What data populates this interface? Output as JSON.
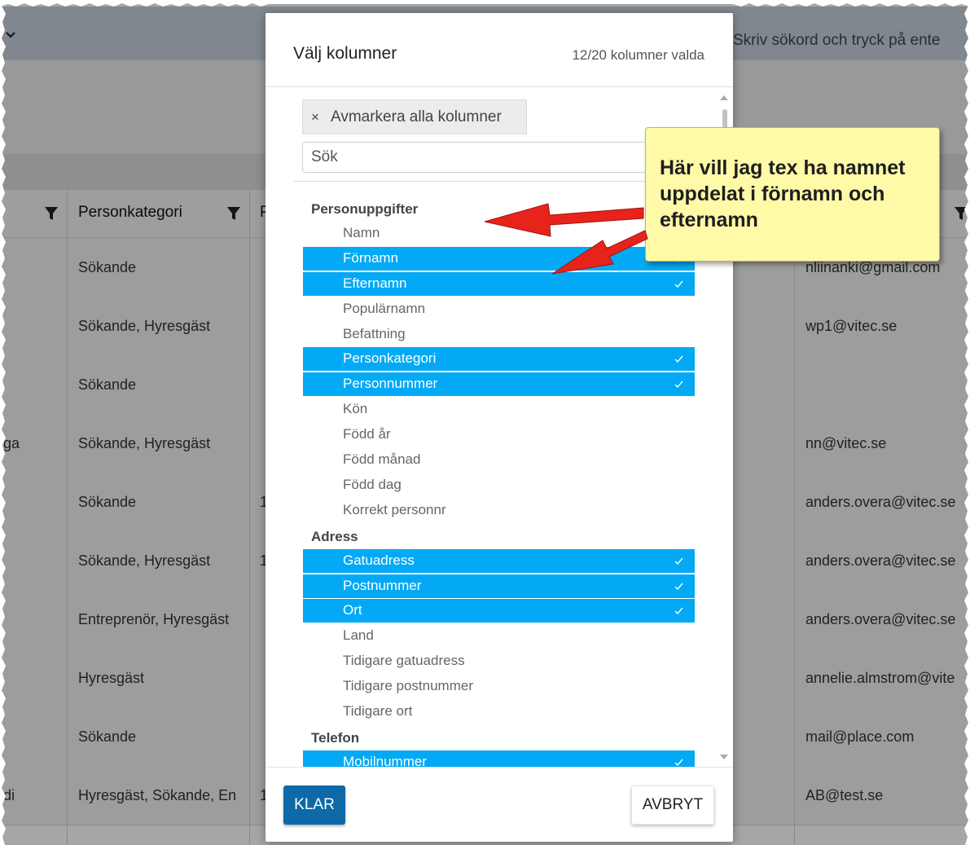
{
  "background": {
    "search_placeholder": "Skriv sökord och tryck på ente",
    "header": {
      "col_personkategori": "Personkategori",
      "col_next_initial": "P"
    },
    "rows": [
      {
        "left": "",
        "kategori": "Sökande",
        "p": "",
        "email": "nliinanki@gmail.com"
      },
      {
        "left": "",
        "kategori": "Sökande, Hyresgäst",
        "p": "",
        "email": "wp1@vitec.se"
      },
      {
        "left": "",
        "kategori": "Sökande",
        "p": "",
        "email": ""
      },
      {
        "left": "ga",
        "kategori": "Sökande, Hyresgäst",
        "p": "",
        "email": "nn@vitec.se"
      },
      {
        "left": "",
        "kategori": "Sökande",
        "p": "1",
        "email": "anders.overa@vitec.se"
      },
      {
        "left": "",
        "kategori": "Sökande, Hyresgäst",
        "p": "1",
        "email": "anders.overa@vitec.se"
      },
      {
        "left": "",
        "kategori": "Entreprenör, Hyresgäst",
        "p": "",
        "email": "anders.overa@vitec.se"
      },
      {
        "left": "",
        "kategori": "Hyresgäst",
        "p": "",
        "email": "annelie.almstrom@vite"
      },
      {
        "left": "",
        "kategori": "Sökande",
        "p": "",
        "email": "mail@place.com"
      },
      {
        "left": "di",
        "kategori": "Hyresgäst, Sökande, En",
        "p": "1",
        "email": "AB@test.se"
      }
    ]
  },
  "modal": {
    "title": "Välj kolumner",
    "count": "12/20 kolumner valda",
    "deselect_icon": "×",
    "deselect_label": "Avmarkera alla kolumner",
    "search_placeholder": "Sök",
    "groups": [
      {
        "title": "Personuppgifter",
        "items": [
          {
            "label": "Namn",
            "selected": false
          },
          {
            "label": "Förnamn",
            "selected": true
          },
          {
            "label": "Efternamn",
            "selected": true
          },
          {
            "label": "Populärnamn",
            "selected": false
          },
          {
            "label": "Befattning",
            "selected": false
          },
          {
            "label": "Personkategori",
            "selected": true
          },
          {
            "label": "Personnummer",
            "selected": true
          },
          {
            "label": "Kön",
            "selected": false
          },
          {
            "label": "Född år",
            "selected": false
          },
          {
            "label": "Född månad",
            "selected": false
          },
          {
            "label": "Född dag",
            "selected": false
          },
          {
            "label": "Korrekt personnr",
            "selected": false
          }
        ]
      },
      {
        "title": "Adress",
        "items": [
          {
            "label": "Gatuadress",
            "selected": true
          },
          {
            "label": "Postnummer",
            "selected": true
          },
          {
            "label": "Ort",
            "selected": true
          },
          {
            "label": "Land",
            "selected": false
          },
          {
            "label": "Tidigare gatuadress",
            "selected": false
          },
          {
            "label": "Tidigare postnummer",
            "selected": false
          },
          {
            "label": "Tidigare ort",
            "selected": false
          }
        ]
      },
      {
        "title": "Telefon",
        "items": [
          {
            "label": "Mobilnummer",
            "selected": true
          }
        ]
      }
    ],
    "ok_label": "KLAR",
    "cancel_label": "AVBRYT"
  },
  "callout": {
    "text": "Här vill jag tex ha namnet uppdelat i förnamn och efternamn"
  },
  "colors": {
    "selected_row": "#03a9f4",
    "primary_button": "#0d69a8",
    "callout_bg": "#fefaa8",
    "arrow": "#e8231c",
    "topbar": "#c7d0da"
  },
  "icons": {
    "check": "check-icon",
    "filter": "funnel-icon",
    "collapse": "chevron-down-icon",
    "close": "close-icon"
  }
}
